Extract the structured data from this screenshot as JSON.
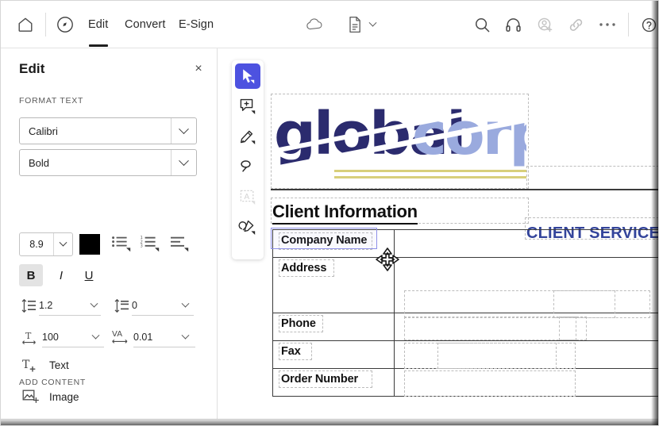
{
  "topbar": {
    "home_icon": "home-icon",
    "logo_icon": "app-logo-icon",
    "tabs": [
      {
        "label": "Edit",
        "active": true
      },
      {
        "label": "Convert",
        "active": false
      },
      {
        "label": "E-Sign",
        "active": false
      }
    ],
    "right_icons": [
      {
        "name": "cloud-icon",
        "label": "Cloud storage"
      },
      {
        "name": "document-icon",
        "label": "Document"
      },
      {
        "name": "chevron-down-icon",
        "label": "Document menu"
      },
      {
        "name": "search-icon",
        "label": "Search"
      },
      {
        "name": "headset-icon",
        "label": "Support"
      },
      {
        "name": "add-person-icon",
        "label": "Share with people"
      },
      {
        "name": "link-icon",
        "label": "Copy link"
      },
      {
        "name": "more-options-icon",
        "label": "More"
      },
      {
        "name": "help-icon",
        "label": "Help"
      }
    ]
  },
  "panel": {
    "title": "Edit",
    "close_label": "×",
    "format_section_label": "FORMAT TEXT",
    "font_family": "Calibri",
    "font_style": "Bold",
    "font_size": "8.9",
    "font_color": "#000000",
    "list_icons": [
      {
        "name": "bullet-list-icon"
      },
      {
        "name": "numbered-list-icon"
      },
      {
        "name": "align-text-icon"
      }
    ],
    "bold_label": "B",
    "italic_label": "I",
    "underline_label": "U",
    "line_spacing": "1.2",
    "paragraph_spacing": "0",
    "horizontal_scale": "100",
    "character_spacing": "0.01",
    "char_spacing_icon_label": "VA",
    "add_content_label": "ADD CONTENT",
    "add_items": [
      {
        "label": "Text",
        "icon": "add-text-icon"
      },
      {
        "label": "Image",
        "icon": "add-image-icon"
      }
    ]
  },
  "tools": [
    {
      "name": "select-tool",
      "active": true
    },
    {
      "name": "comment-tool",
      "active": false
    },
    {
      "name": "highlight-tool",
      "active": false
    },
    {
      "name": "draw-lasso-tool",
      "active": false
    },
    {
      "name": "text-box-tool",
      "active": false,
      "disabled": true
    },
    {
      "name": "signature-tool",
      "active": false
    }
  ],
  "document": {
    "logo": {
      "part_one": "global",
      "part_two": "corp",
      "color_one": "#2b2b6e",
      "color_two": "#9aaade",
      "accent_line_color": "#d8cf7a"
    },
    "client_service_text": "CLIENT SERVICE",
    "client_service_color": "#33449b",
    "heading": "Client Information",
    "table_rows": [
      {
        "label": "Company Name",
        "value": "",
        "selected": true
      },
      {
        "label": "Address",
        "value": "",
        "selected": false
      },
      {
        "label": "Phone",
        "value": "",
        "selected": false
      },
      {
        "label": "Fax",
        "value": "",
        "selected": false
      },
      {
        "label": "Order Number",
        "value": "",
        "selected": false
      }
    ],
    "cursor": "move-cursor"
  }
}
